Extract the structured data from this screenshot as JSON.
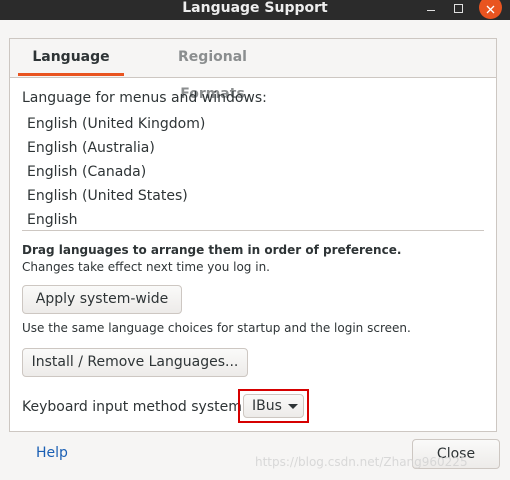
{
  "window": {
    "title": "Language Support"
  },
  "tabs": [
    {
      "label": "Language",
      "active": true
    },
    {
      "label": "Regional Formats",
      "active": false
    }
  ],
  "language": {
    "menus_label": "Language for menus and windows:",
    "languages": [
      "English (United Kingdom)",
      "English (Australia)",
      "English (Canada)",
      "English (United States)",
      "English"
    ],
    "drag_hint_bold": "Drag languages to arrange them in order of preference.",
    "drag_hint": "Changes take effect next time you log in.",
    "apply_button": "Apply system-wide",
    "startup_note": "Use the same language choices for startup and the login screen.",
    "install_button": "Install / Remove Languages...",
    "keyboard_label": "Keyboard input method system:",
    "keyboard_value": "IBus"
  },
  "footer": {
    "help_label": "Help",
    "close_label": "Close"
  },
  "watermark": "https://blog.csdn.net/Zhang960225",
  "colors": {
    "accent": "#e95420",
    "highlight_box": "#d60000",
    "link": "#1a5fb4"
  }
}
